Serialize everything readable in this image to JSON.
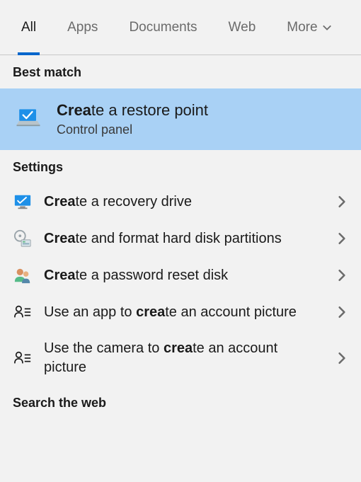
{
  "tabs": {
    "all": "All",
    "apps": "Apps",
    "documents": "Documents",
    "web": "Web",
    "more": "More"
  },
  "sections": {
    "best_match": "Best match",
    "settings": "Settings",
    "search_web": "Search the web"
  },
  "search_bold": "crea",
  "best_match": {
    "title_bold": "Crea",
    "title_rest": "te a restore point",
    "subtitle": "Control panel"
  },
  "settings_items": [
    {
      "bold": "Crea",
      "rest": "te a recovery drive",
      "icon": "monitor"
    },
    {
      "bold": "Crea",
      "rest": "te and format hard disk partitions",
      "icon": "disk"
    },
    {
      "bold": "Crea",
      "rest": "te a password reset disk",
      "icon": "users"
    },
    {
      "pre": "Use an app to ",
      "bold": "crea",
      "rest": "te an account picture",
      "icon": "account"
    },
    {
      "pre": "Use the camera to ",
      "bold": "crea",
      "rest": "te an account picture",
      "icon": "account"
    }
  ]
}
